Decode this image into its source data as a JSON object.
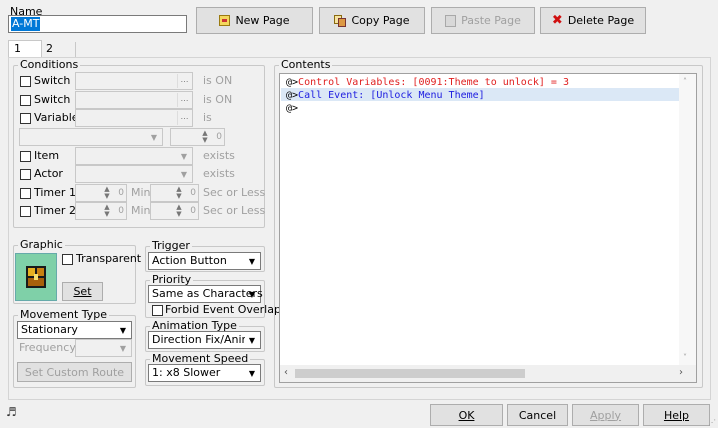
{
  "name": {
    "label": "Name",
    "value": "A-MT"
  },
  "toolbar": {
    "new_page": "New Page",
    "copy_page": "Copy Page",
    "paste_page": "Paste Page",
    "delete_page": "Delete Page"
  },
  "tabs": [
    {
      "label": "1"
    },
    {
      "label": "2"
    }
  ],
  "conditions": {
    "legend": "Conditions",
    "switch1": {
      "label": "Switch",
      "suffix": "is ON"
    },
    "switch2": {
      "label": "Switch",
      "suffix": "is ON"
    },
    "variable": {
      "label": "Variable",
      "suffix": "is"
    },
    "item": {
      "label": "Item",
      "suffix": "exists"
    },
    "actor": {
      "label": "Actor",
      "suffix": "exists"
    },
    "timer1": {
      "label": "Timer 1",
      "min": "Min",
      "sec": "Sec or Less",
      "v1": "0",
      "v2": "0"
    },
    "timer2": {
      "label": "Timer 2",
      "min": "Min",
      "sec": "Sec or Less",
      "v1": "0",
      "v2": "0"
    },
    "var_value": "0"
  },
  "graphic": {
    "legend": "Graphic",
    "transparent": "Transparent",
    "set": "Set"
  },
  "trigger": {
    "legend": "Trigger",
    "value": "Action Button"
  },
  "priority": {
    "legend": "Priority",
    "value": "Same as Characters",
    "forbid": "Forbid Event Overlap"
  },
  "movement_type": {
    "legend": "Movement Type",
    "value": "Stationary",
    "frequency": "Frequency:",
    "custom_route": "Set Custom Route"
  },
  "animation_type": {
    "legend": "Animation Type",
    "value": "Direction Fix/Animated"
  },
  "movement_speed": {
    "legend": "Movement Speed",
    "value": "1: x8 Slower"
  },
  "contents": {
    "legend": "Contents",
    "lines": [
      {
        "prefix": "@>",
        "text": "Control Variables: [0091:Theme to unlock] = 3",
        "color": "#e02020"
      },
      {
        "prefix": "@>",
        "text": "Call Event: [Unlock Menu Theme]",
        "color": "#2020e0"
      },
      {
        "prefix": "@>",
        "text": "",
        "color": "#000000"
      }
    ]
  },
  "footer": {
    "ok": "OK",
    "cancel": "Cancel",
    "apply": "Apply",
    "help": "Help"
  },
  "icons": {
    "music": "music-note-icon"
  }
}
